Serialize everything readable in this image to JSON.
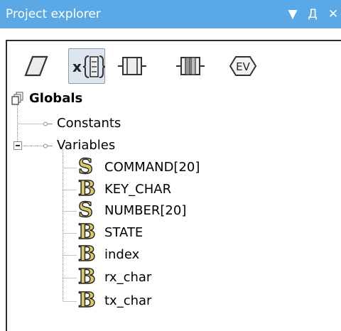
{
  "window": {
    "title": "Project explorer",
    "menu_glyph": "▼",
    "pin_glyph": "Д",
    "close_glyph": "✕",
    "title_bar_color": "#5aa9e6"
  },
  "toolbar": {
    "tools": [
      {
        "icon": "parallelogram-icon",
        "active": false
      },
      {
        "icon": "variables-braces-icon",
        "active": true,
        "label": "x"
      },
      {
        "icon": "function-block-icon",
        "active": false
      },
      {
        "icon": "library-block-icon",
        "active": false
      },
      {
        "icon": "event-icon",
        "active": false,
        "label": "EV"
      }
    ]
  },
  "tree": {
    "root": {
      "label": "Globals",
      "icon": "globals-icon"
    },
    "constants": {
      "label": "Constants"
    },
    "variables": {
      "label": "Variables",
      "expanded": true
    },
    "items": [
      {
        "type_letter": "S",
        "label": "COMMAND[20]"
      },
      {
        "type_letter": "B",
        "label": "KEY_CHAR"
      },
      {
        "type_letter": "S",
        "label": "NUMBER[20]"
      },
      {
        "type_letter": "B",
        "label": "STATE"
      },
      {
        "type_letter": "B",
        "label": "index"
      },
      {
        "type_letter": "B",
        "label": "rx_char"
      },
      {
        "type_letter": "B",
        "label": "tx_char"
      }
    ]
  }
}
